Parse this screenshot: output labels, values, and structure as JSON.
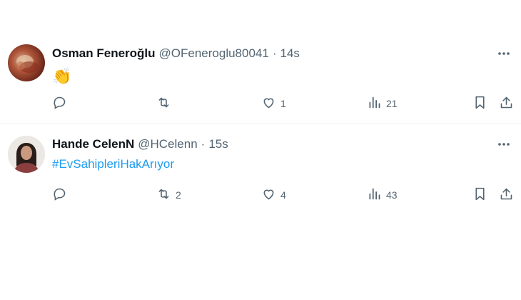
{
  "tweets": [
    {
      "name": "Osman Feneroğlu",
      "handle": "@OFeneroglu80041",
      "separator": "·",
      "time": "14s",
      "text": "👏",
      "reply_count": "",
      "retweet_count": "",
      "like_count": "1",
      "view_count": "21"
    },
    {
      "name": "Hande CelenN",
      "handle": "@HCelenn",
      "separator": "·",
      "time": "15s",
      "text": "#EvSahipleriHakArıyor",
      "reply_count": "",
      "retweet_count": "2",
      "like_count": "4",
      "view_count": "43"
    }
  ],
  "colors": {
    "text": "#0f1419",
    "secondary": "#536471",
    "link": "#1d9bf0",
    "divider": "#eff3f4"
  },
  "icons": [
    "more-icon",
    "reply-icon",
    "retweet-icon",
    "like-icon",
    "views-icon",
    "bookmark-icon",
    "share-icon"
  ]
}
